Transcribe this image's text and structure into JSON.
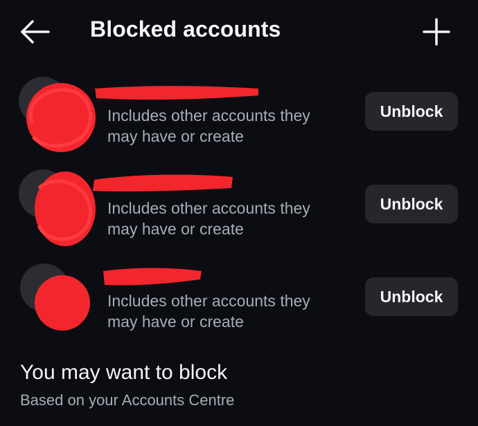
{
  "header": {
    "back_icon": "arrow-left-icon",
    "title": "Blocked accounts",
    "add_icon": "plus-icon"
  },
  "blocked_accounts": [
    {
      "subtitle_line1": "Includes other accounts they",
      "subtitle_line2": "may have or create",
      "button_label": "Unblock"
    },
    {
      "subtitle_line1": "Includes other accounts they",
      "subtitle_line2": "may have or create",
      "button_label": "Unblock"
    },
    {
      "subtitle_line1": "Includes other accounts they",
      "subtitle_line2": "may have or create",
      "button_label": "Unblock"
    }
  ],
  "suggestions": {
    "title": "You may want to block",
    "subtitle": "Based on your Accounts Centre"
  },
  "colors": {
    "background": "#0b0d12",
    "button_background": "#25272d",
    "secondary_text": "#a7adb6",
    "redaction": "#f4262d"
  }
}
